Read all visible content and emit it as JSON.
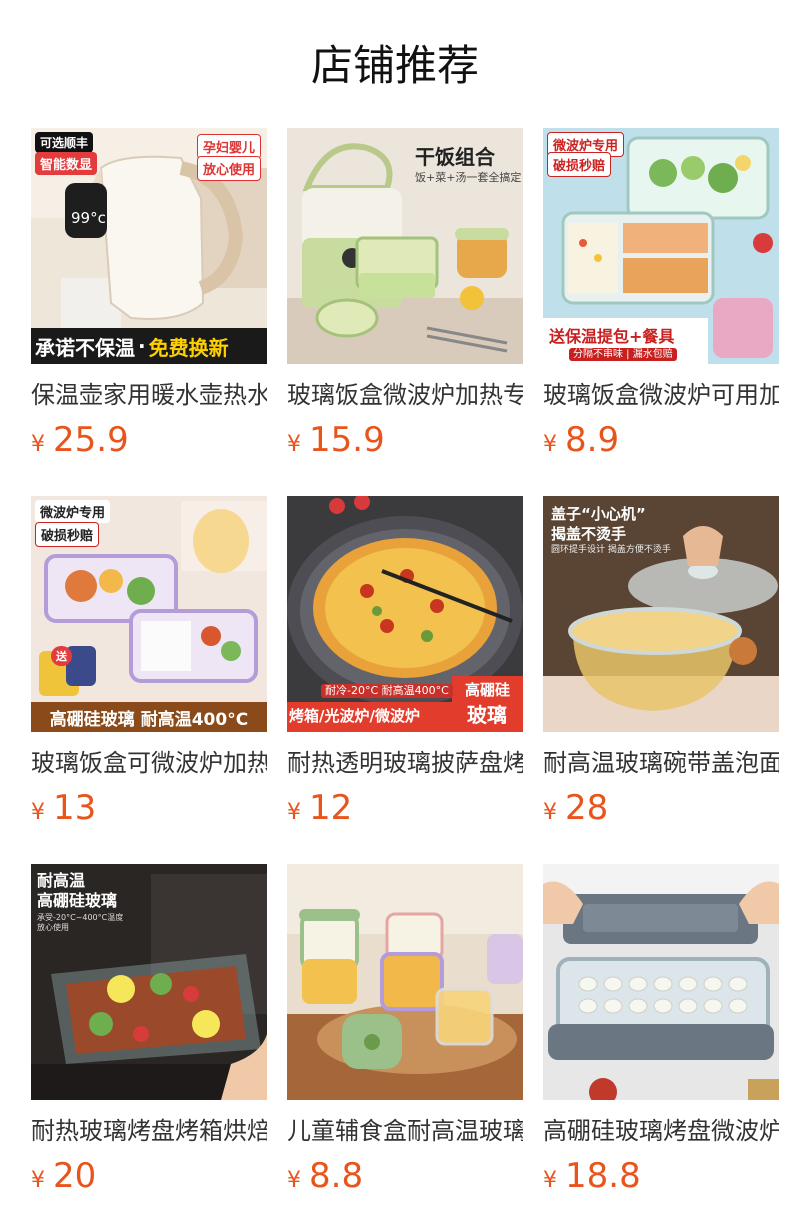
{
  "title": "店铺推荐",
  "currency_symbol": "¥",
  "price_color": "#e8551c",
  "products": [
    {
      "name": "保温壶家用暖水壶热水",
      "price": "25.9",
      "image": {
        "badges": [
          "可选顺丰",
          "智能数显",
          "孕妇婴儿",
          "放心使用"
        ],
        "temp": "99°c",
        "banner_left": "承诺不保温",
        "banner_right": "免费换新"
      }
    },
    {
      "name": "玻璃饭盒微波炉加热专",
      "price": "15.9",
      "image": {
        "headline": "干饭组合",
        "subline": "饭+菜+汤一套全搞定"
      }
    },
    {
      "name": "玻璃饭盒微波炉可用加",
      "price": "8.9",
      "image": {
        "tag1": "微波炉专用",
        "tag2": "破损秒赔",
        "banner": "送保温提包+餐具",
        "banner_sub": "分隔不串味 | 漏水包赔"
      }
    },
    {
      "name": "玻璃饭盒可微波炉加热",
      "price": "13",
      "image": {
        "tag1": "微波炉专用",
        "tag2": "破损秒赔",
        "bag_tag": "送",
        "banner": "高硼硅玻璃 耐高温400°C"
      }
    },
    {
      "name": "耐热透明玻璃披萨盘烤",
      "price": "12",
      "image": {
        "temp_label": "耐冷-20°C 耐高温400°C",
        "banner_left": "烤箱/光波炉/微波炉",
        "corner_top": "高硼硅",
        "corner_bottom": "玻璃"
      }
    },
    {
      "name": "耐高温玻璃碗带盖泡面",
      "price": "28",
      "image": {
        "headline": "盖子“小心机”",
        "headline2": "揭盖不烫手",
        "subline": "圆环提手设计 揭盖方便不烫手"
      }
    },
    {
      "name": "耐热玻璃烤盘烤箱烘焙",
      "price": "20",
      "image": {
        "headline": "耐高温",
        "headline2": "高硼硅玻璃",
        "subline": "承受-20°C~400°C温度",
        "subline2": "放心使用"
      }
    },
    {
      "name": "儿童辅食盒耐高温玻璃",
      "price": "8.8",
      "image": {}
    },
    {
      "name": "高硼硅玻璃烤盘微波炉",
      "price": "18.8",
      "image": {}
    }
  ]
}
